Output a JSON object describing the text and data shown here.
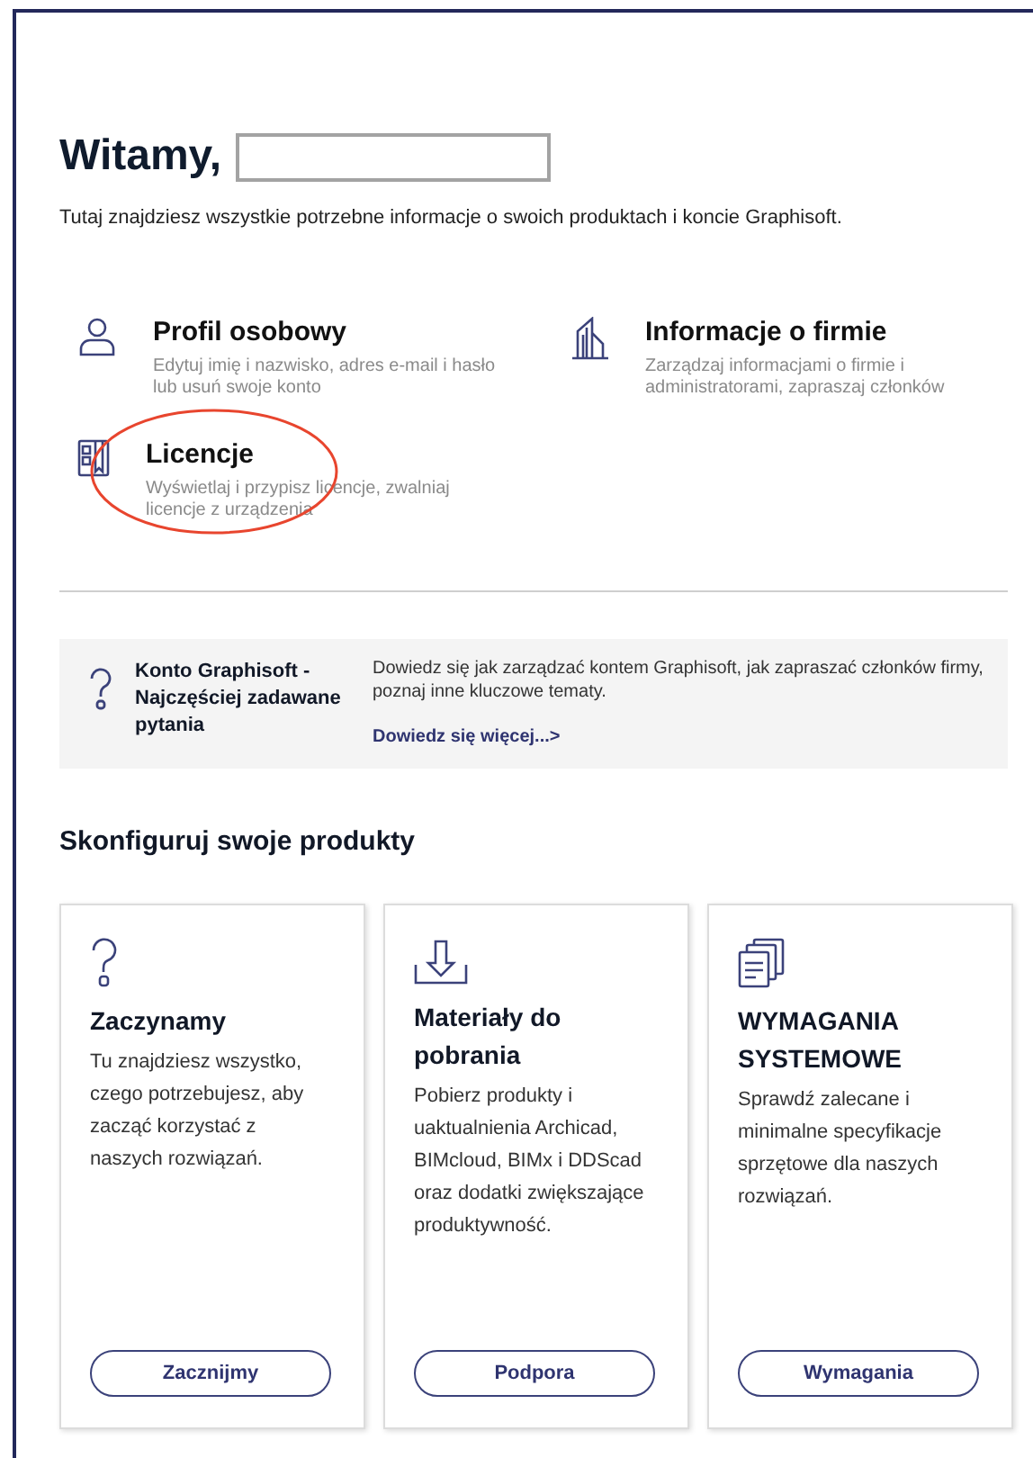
{
  "welcome": {
    "title": "Witamy,",
    "subtitle": "Tutaj znajdziesz wszystkie potrzebne informacje o swoich produktach i koncie Graphisoft."
  },
  "links": [
    {
      "kind": "person",
      "title": "Profil osobowy",
      "description": "Edytuj imię i nazwisko, adres e-mail i hasło lub usuń swoje konto",
      "circled": false
    },
    {
      "kind": "building",
      "title": "Informacje o firmie",
      "description": "Zarządzaj informacjami o firmie i administratorami, zapraszaj członków",
      "circled": false
    },
    {
      "kind": "license",
      "title": "Licencje",
      "description": "Wyświetlaj i przypisz licencje, zwalniaj licencje z urządzenia",
      "circled": true
    }
  ],
  "faq": {
    "title": "Konto Graphisoft - Najczęściej zadawane pytania",
    "description": "Dowiedz się jak zarządzać kontem Graphisoft, jak zapraszać członków firmy, poznaj inne kluczowe tematy.",
    "link": "Dowiedz się więcej...>"
  },
  "products": {
    "heading": "Skonfiguruj swoje produkty",
    "cards": [
      {
        "kind": "question",
        "title": "Zaczynamy",
        "description": "Tu znajdziesz wszystko, czego potrzebujesz, aby zacząć korzystać z naszych rozwiązań.",
        "button": "Zacznijmy"
      },
      {
        "kind": "download",
        "title": "Materiały do pobrania",
        "description": "Pobierz produkty i uaktualnienia Archicad, BIMcloud, BIMx i DDScad oraz dodatki zwiększające produktywność.",
        "button": "Podpora"
      },
      {
        "kind": "documents",
        "title": "WYMAGANIA SYSTEMOWE",
        "description": "Sprawdź zalecane i minimalne specyfikacje sprzętowe dla naszych rozwiązań.",
        "button": "Wymagania"
      }
    ]
  }
}
